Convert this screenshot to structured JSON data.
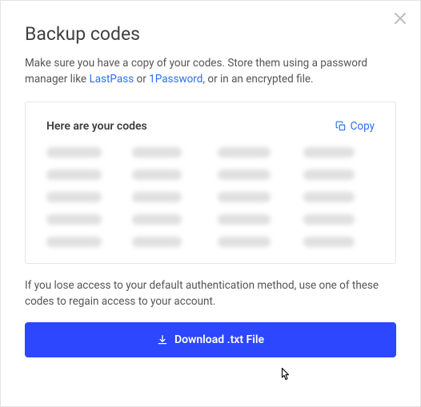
{
  "modal": {
    "title": "Backup codes",
    "subtitle_pre": "Make sure you have a copy of your codes. Store them using a password manager like ",
    "link1": "LastPass",
    "subtitle_mid": " or ",
    "link2": "1Password",
    "subtitle_post": ", or in an encrypted file."
  },
  "codes_box": {
    "header": "Here are your codes",
    "copy_label": "Copy"
  },
  "info": "If you lose access to your default authentication method, use one of these codes to regain access to your account.",
  "download": {
    "label": "Download .txt File"
  }
}
